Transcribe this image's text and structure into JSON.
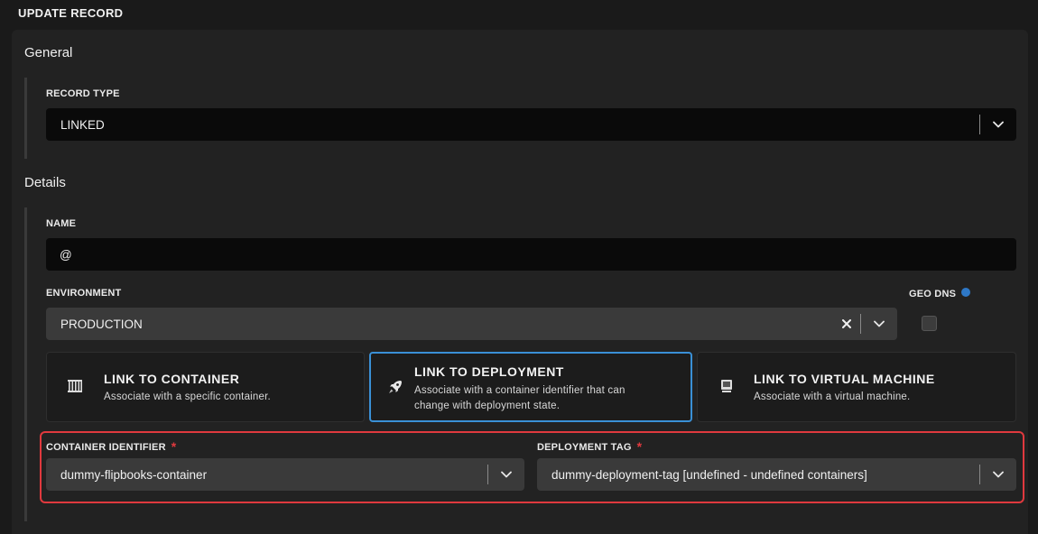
{
  "page": {
    "title": "UPDATE RECORD"
  },
  "general": {
    "title": "General",
    "record_type": {
      "label": "RECORD TYPE",
      "value": "LINKED"
    }
  },
  "details": {
    "title": "Details",
    "name": {
      "label": "NAME",
      "value": "@"
    },
    "environment": {
      "label": "ENVIRONMENT",
      "value": "PRODUCTION"
    },
    "geo_dns": {
      "label": "GEO DNS",
      "checked": false
    }
  },
  "link_options": [
    {
      "title": "LINK TO CONTAINER",
      "desc_line1": "Associate with a specific container.",
      "desc_line2": "",
      "icon": "container-icon",
      "selected": false
    },
    {
      "title": "LINK TO DEPLOYMENT",
      "desc_line1": "Associate with a container identifier that can",
      "desc_line2": "change with deployment state.",
      "icon": "rocket-icon",
      "selected": true
    },
    {
      "title": "LINK TO VIRTUAL MACHINE",
      "desc_line1": "Associate with a virtual machine.",
      "desc_line2": "",
      "icon": "monitor-icon",
      "selected": false
    }
  ],
  "container_identifier": {
    "label": "CONTAINER IDENTIFIER",
    "required_mark": "*",
    "value": "dummy-flipbooks-container"
  },
  "deployment_tag": {
    "label": "DEPLOYMENT TAG",
    "required_mark": "*",
    "value": "dummy-deployment-tag [undefined - undefined containers]"
  },
  "colors": {
    "accent": "#3a90d6",
    "required": "#e0393e",
    "highlight": "#e0393e",
    "info": "#2e78c7"
  }
}
